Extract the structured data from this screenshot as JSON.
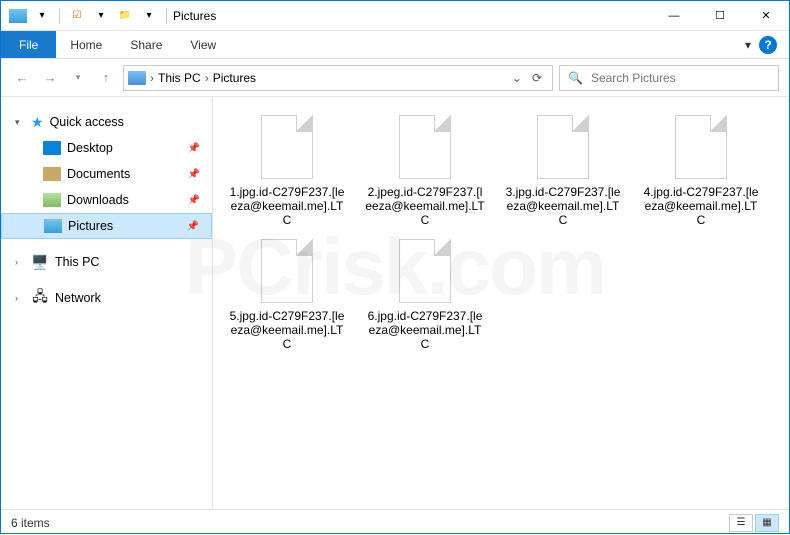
{
  "titlebar": {
    "title": "Pictures",
    "minimize": "—",
    "maximize": "☐",
    "close": "✕"
  },
  "ribbon": {
    "file": "File",
    "tabs": [
      "Home",
      "Share",
      "View"
    ],
    "expand": "▾",
    "help": "?"
  },
  "breadcrumb": {
    "sep": "›",
    "items": [
      "This PC",
      "Pictures"
    ],
    "refresh": "⟳"
  },
  "search": {
    "placeholder": "Search Pictures",
    "icon": "🔍"
  },
  "nav": {
    "quick_access": {
      "expand": "▾",
      "label": "Quick access",
      "items": [
        {
          "label": "Desktop",
          "pin": "📌",
          "icon_class": "ico-desktop"
        },
        {
          "label": "Documents",
          "pin": "📌",
          "icon_class": "ico-doc"
        },
        {
          "label": "Downloads",
          "pin": "📌",
          "icon_class": "ico-down"
        },
        {
          "label": "Pictures",
          "pin": "📌",
          "icon_class": "ico-pic",
          "selected": true
        }
      ]
    },
    "this_pc": {
      "expand": "›",
      "label": "This PC"
    },
    "network": {
      "expand": "›",
      "label": "Network"
    }
  },
  "files": [
    {
      "name": "1.jpg.id-C279F237.[leeza@keemail.me].LTC"
    },
    {
      "name": "2.jpeg.id-C279F237.[leeza@keemail.me].LTC"
    },
    {
      "name": "3.jpg.id-C279F237.[leeza@keemail.me].LTC"
    },
    {
      "name": "4.jpg.id-C279F237.[leeza@keemail.me].LTC"
    },
    {
      "name": "5.jpg.id-C279F237.[leeza@keemail.me].LTC"
    },
    {
      "name": "6.jpg.id-C279F237.[leeza@keemail.me].LTC"
    }
  ],
  "status": {
    "count": "6 items"
  }
}
